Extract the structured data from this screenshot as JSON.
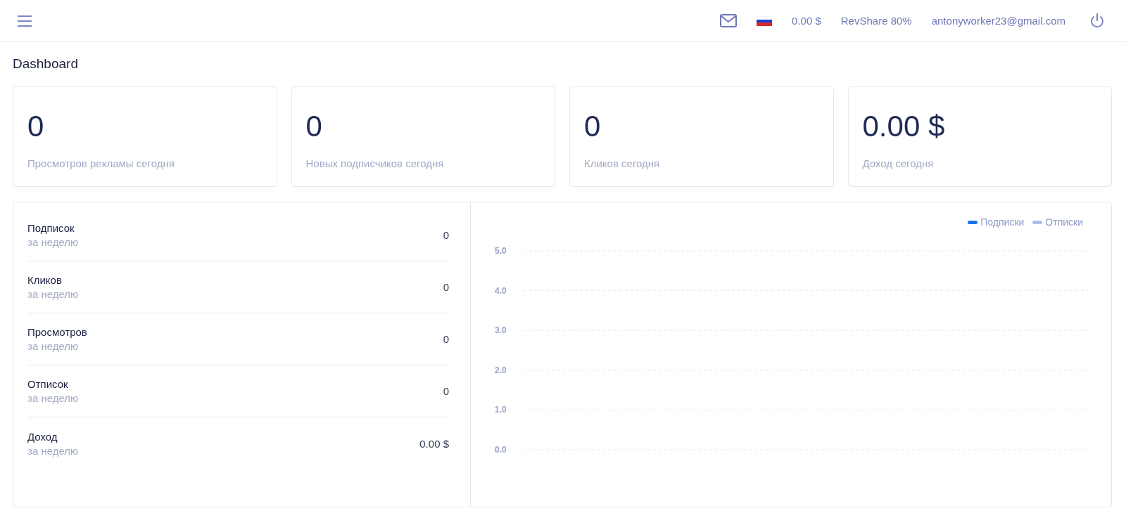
{
  "topbar": {
    "balance": "0.00 $",
    "revshare": "RevShare 80%",
    "email": "antonyworker23@gmail.com"
  },
  "page_title": "Dashboard",
  "stats": [
    {
      "value": "0",
      "label": "Просмотров рекламы сегодня"
    },
    {
      "value": "0",
      "label": "Новых подписчиков сегодня"
    },
    {
      "value": "0",
      "label": "Кликов сегодня"
    },
    {
      "value": "0.00 $",
      "label": "Доход сегодня"
    }
  ],
  "weekly": [
    {
      "title": "Подписок",
      "period": "за неделю",
      "value": "0"
    },
    {
      "title": "Кликов",
      "period": "за неделю",
      "value": "0"
    },
    {
      "title": "Просмотров",
      "period": "за неделю",
      "value": "0"
    },
    {
      "title": "Отписок",
      "period": "за неделю",
      "value": "0"
    },
    {
      "title": "Доход",
      "period": "за неделю",
      "value": "0.00 $"
    }
  ],
  "chart_data": {
    "type": "line",
    "grid": true,
    "ylim": [
      0,
      5
    ],
    "yticks": [
      {
        "value": 0,
        "label": "0.0"
      },
      {
        "value": 1,
        "label": "1.0"
      },
      {
        "value": 2,
        "label": "2.0"
      },
      {
        "value": 3,
        "label": "3.0"
      },
      {
        "value": 4,
        "label": "4.0"
      },
      {
        "value": 5,
        "label": "5.0"
      }
    ],
    "series": [
      {
        "name": "Подписки",
        "color": "#1a73e8"
      },
      {
        "name": "Отписки",
        "color": "#a3c1ee"
      }
    ]
  }
}
